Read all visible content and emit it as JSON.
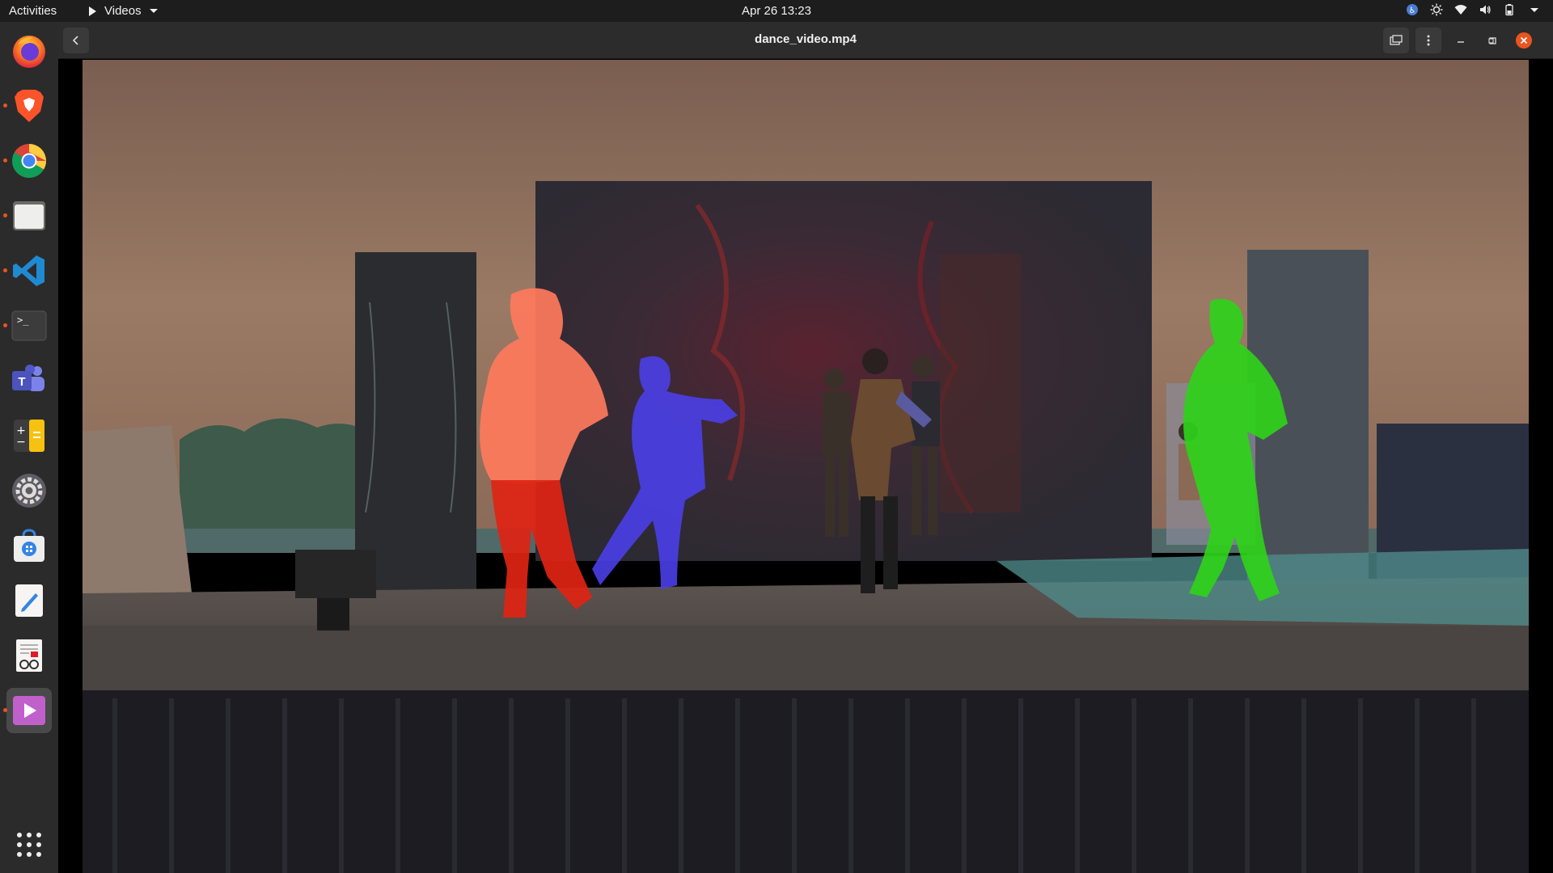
{
  "topbar": {
    "activities": "Activities",
    "app_name": "Videos",
    "clock": "Apr 26  13:23"
  },
  "dock": {
    "items": [
      {
        "name": "firefox-icon",
        "running": false
      },
      {
        "name": "brave-icon",
        "running": true
      },
      {
        "name": "chrome-icon",
        "running": true
      },
      {
        "name": "files-icon",
        "running": true
      },
      {
        "name": "vscode-icon",
        "running": true
      },
      {
        "name": "terminal-icon",
        "running": true
      },
      {
        "name": "teams-icon",
        "running": false
      },
      {
        "name": "calculator-icon",
        "running": false
      },
      {
        "name": "settings-icon",
        "running": false
      },
      {
        "name": "software-icon",
        "running": false
      },
      {
        "name": "text-editor-icon",
        "running": false
      },
      {
        "name": "document-viewer-icon",
        "running": false
      },
      {
        "name": "videos-icon",
        "running": true,
        "active": true
      }
    ],
    "apps_grid_icon": "show-apps-icon"
  },
  "window": {
    "title": "dance_video.mp4"
  },
  "colors": {
    "accent": "#e95420",
    "close": "#e95420",
    "topbar": "#1d1d1d",
    "dock": "#2b2b2b",
    "headerbar": "#2c2c2c",
    "mask_red": "#ff3b1f",
    "mask_blue": "#4a3fff",
    "mask_green": "#2ecc1a"
  }
}
